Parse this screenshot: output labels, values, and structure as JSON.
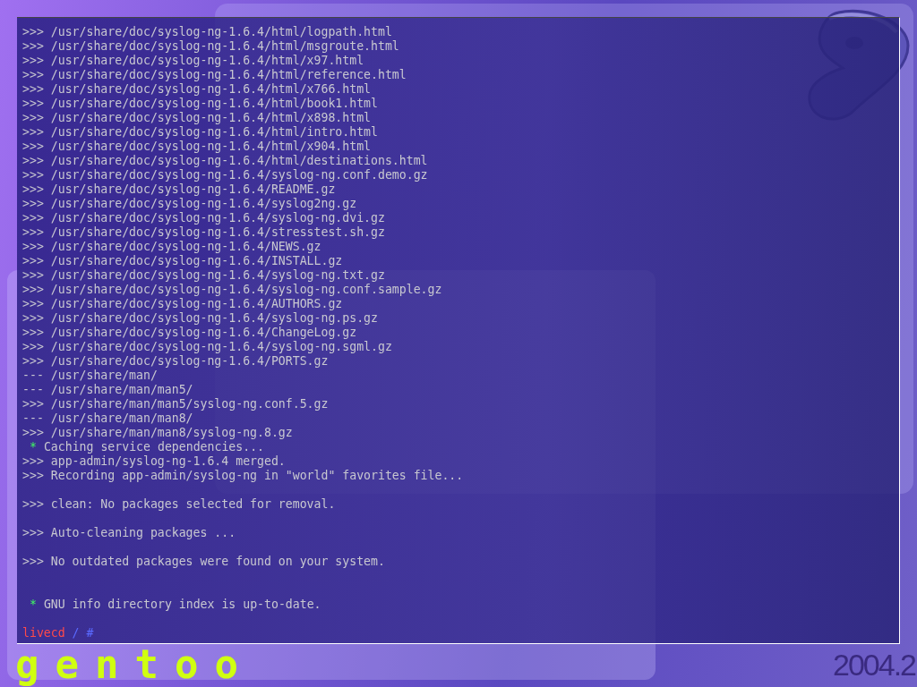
{
  "terminal": {
    "lines": [
      {
        "kind": "text",
        "text": ">>> /usr/share/doc/syslog-ng-1.6.4/html/logpath.html"
      },
      {
        "kind": "text",
        "text": ">>> /usr/share/doc/syslog-ng-1.6.4/html/msgroute.html"
      },
      {
        "kind": "text",
        "text": ">>> /usr/share/doc/syslog-ng-1.6.4/html/x97.html"
      },
      {
        "kind": "text",
        "text": ">>> /usr/share/doc/syslog-ng-1.6.4/html/reference.html"
      },
      {
        "kind": "text",
        "text": ">>> /usr/share/doc/syslog-ng-1.6.4/html/x766.html"
      },
      {
        "kind": "text",
        "text": ">>> /usr/share/doc/syslog-ng-1.6.4/html/book1.html"
      },
      {
        "kind": "text",
        "text": ">>> /usr/share/doc/syslog-ng-1.6.4/html/x898.html"
      },
      {
        "kind": "text",
        "text": ">>> /usr/share/doc/syslog-ng-1.6.4/html/intro.html"
      },
      {
        "kind": "text",
        "text": ">>> /usr/share/doc/syslog-ng-1.6.4/html/x904.html"
      },
      {
        "kind": "text",
        "text": ">>> /usr/share/doc/syslog-ng-1.6.4/html/destinations.html"
      },
      {
        "kind": "text",
        "text": ">>> /usr/share/doc/syslog-ng-1.6.4/syslog-ng.conf.demo.gz"
      },
      {
        "kind": "text",
        "text": ">>> /usr/share/doc/syslog-ng-1.6.4/README.gz"
      },
      {
        "kind": "text",
        "text": ">>> /usr/share/doc/syslog-ng-1.6.4/syslog2ng.gz"
      },
      {
        "kind": "text",
        "text": ">>> /usr/share/doc/syslog-ng-1.6.4/syslog-ng.dvi.gz"
      },
      {
        "kind": "text",
        "text": ">>> /usr/share/doc/syslog-ng-1.6.4/stresstest.sh.gz"
      },
      {
        "kind": "text",
        "text": ">>> /usr/share/doc/syslog-ng-1.6.4/NEWS.gz"
      },
      {
        "kind": "text",
        "text": ">>> /usr/share/doc/syslog-ng-1.6.4/INSTALL.gz"
      },
      {
        "kind": "text",
        "text": ">>> /usr/share/doc/syslog-ng-1.6.4/syslog-ng.txt.gz"
      },
      {
        "kind": "text",
        "text": ">>> /usr/share/doc/syslog-ng-1.6.4/syslog-ng.conf.sample.gz"
      },
      {
        "kind": "text",
        "text": ">>> /usr/share/doc/syslog-ng-1.6.4/AUTHORS.gz"
      },
      {
        "kind": "text",
        "text": ">>> /usr/share/doc/syslog-ng-1.6.4/syslog-ng.ps.gz"
      },
      {
        "kind": "text",
        "text": ">>> /usr/share/doc/syslog-ng-1.6.4/ChangeLog.gz"
      },
      {
        "kind": "text",
        "text": ">>> /usr/share/doc/syslog-ng-1.6.4/syslog-ng.sgml.gz"
      },
      {
        "kind": "text",
        "text": ">>> /usr/share/doc/syslog-ng-1.6.4/PORTS.gz"
      },
      {
        "kind": "text",
        "text": "--- /usr/share/man/"
      },
      {
        "kind": "text",
        "text": "--- /usr/share/man/man5/"
      },
      {
        "kind": "text",
        "text": ">>> /usr/share/man/man5/syslog-ng.conf.5.gz"
      },
      {
        "kind": "text",
        "text": "--- /usr/share/man/man8/"
      },
      {
        "kind": "text",
        "text": ">>> /usr/share/man/man8/syslog-ng.8.gz"
      },
      {
        "kind": "star",
        "marker": "*",
        "text": "Caching service dependencies..."
      },
      {
        "kind": "text",
        "text": ">>> app-admin/syslog-ng-1.6.4 merged."
      },
      {
        "kind": "text",
        "text": ">>> Recording app-admin/syslog-ng in \"world\" favorites file..."
      },
      {
        "kind": "blank"
      },
      {
        "kind": "text",
        "text": ">>> clean: No packages selected for removal."
      },
      {
        "kind": "blank"
      },
      {
        "kind": "text",
        "text": ">>> Auto-cleaning packages ..."
      },
      {
        "kind": "blank"
      },
      {
        "kind": "text",
        "text": ">>> No outdated packages were found on your system."
      },
      {
        "kind": "blank"
      },
      {
        "kind": "blank"
      },
      {
        "kind": "star",
        "marker": "*",
        "text": "GNU info directory index is up-to-date."
      },
      {
        "kind": "blank"
      },
      {
        "kind": "prompt",
        "host": "livecd",
        "path": "/",
        "symbol": "#"
      }
    ]
  },
  "footer": {
    "logo_text": "gentoo",
    "version": "2004.2"
  }
}
